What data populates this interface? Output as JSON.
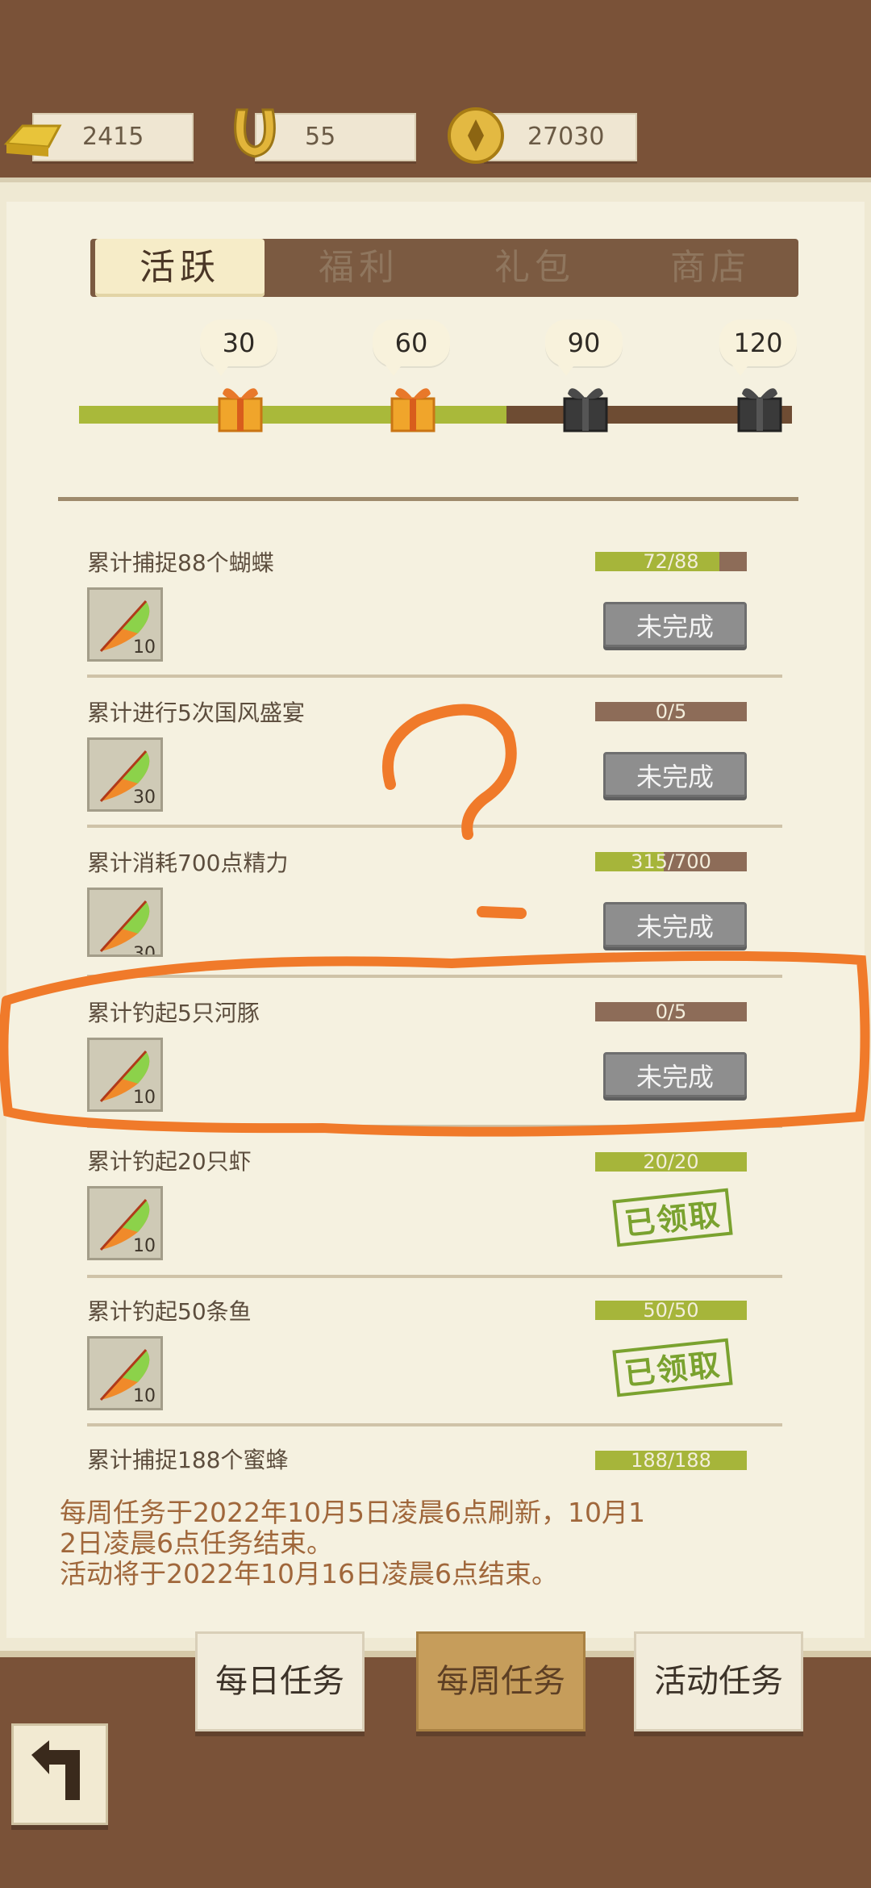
{
  "currencies": {
    "gold": "2415",
    "horseshoe": "55",
    "coin": "27030"
  },
  "tabs": [
    "活跃",
    "福利",
    "礼包",
    "商店"
  ],
  "milestones": [
    "30",
    "60",
    "90",
    "120"
  ],
  "activity_progress": 0.6,
  "tasks": [
    {
      "title": "累计捕捉88个蝴蝶",
      "progress": "72/88",
      "fill": 0.82,
      "reward": "10",
      "status": "未完成"
    },
    {
      "title": "累计进行5次国风盛宴",
      "progress": "0/5",
      "fill": 0,
      "reward": "30",
      "status": "未完成"
    },
    {
      "title": "累计消耗700点精力",
      "progress": "315/700",
      "fill": 0.45,
      "reward": "30",
      "status": "未完成"
    },
    {
      "title": "累计钓起5只河豚",
      "progress": "0/5",
      "fill": 0,
      "reward": "10",
      "status": "未完成"
    },
    {
      "title": "累计钓起20只虾",
      "progress": "20/20",
      "fill": 1,
      "reward": "10",
      "status": "已领取"
    },
    {
      "title": "累计钓起50条鱼",
      "progress": "50/50",
      "fill": 1,
      "reward": "10",
      "status": "已领取"
    },
    {
      "title": "累计捕捉188个蜜蜂",
      "progress": "188/188",
      "fill": 1
    }
  ],
  "notice": {
    "line1": "每周任务于2022年10月5日凌晨6点刷新，10月1",
    "line2": "2日凌晨6点任务结束。",
    "line3": "活动将于2022年10月16日凌晨6点结束。"
  },
  "bottom_tabs": [
    "每日任务",
    "每周任务",
    "活动任务"
  ],
  "colors": {
    "background": "#7a5238",
    "panel": "#f5f1e0",
    "progress_green": "#a9b93a",
    "stamp_green": "#7aa22f",
    "annotation_orange": "#f07a2a"
  }
}
